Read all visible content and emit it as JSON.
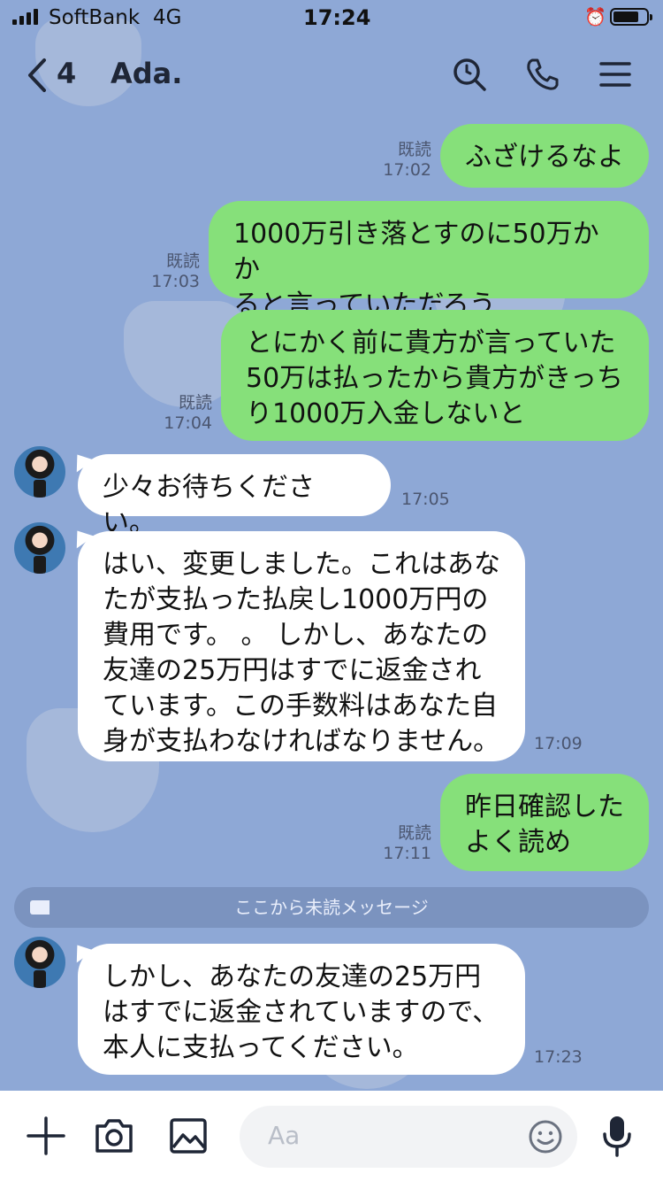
{
  "status_bar": {
    "carrier": "SoftBank",
    "network": "4G",
    "time": "17:24"
  },
  "header": {
    "unread_count": "4",
    "contact_name": "Ada."
  },
  "messages": [
    {
      "direction": "out",
      "text": [
        "ふざけるなよ"
      ],
      "read": "既読",
      "time": "17:02"
    },
    {
      "direction": "out",
      "text": [
        "1000万引き落とすのに50万かか",
        "ると言っていただろう"
      ],
      "read": "既読",
      "time": "17:03"
    },
    {
      "direction": "out",
      "text": [
        "とにかく前に貴方が言っていた",
        "50万は払ったから貴方がきっち",
        "り1000万入金しないと"
      ],
      "read": "既読",
      "time": "17:04"
    },
    {
      "direction": "in",
      "text": [
        "少々お待ちください。"
      ],
      "time": "17:05"
    },
    {
      "direction": "in",
      "text": [
        "はい、変更しました。これはあな",
        "たが支払った払戻し1000万円の",
        "費用です。 。 しかし、あなたの",
        "友達の25万円はすでに返金され",
        "ています。この手数料はあなた自",
        "身が支払わなければなりません。"
      ],
      "time": "17:09"
    },
    {
      "direction": "out",
      "text": [
        "昨日確認した",
        "よく読め"
      ],
      "read": "既読",
      "time": "17:11"
    },
    {
      "direction": "in",
      "text": [
        "しかし、あなたの友達の25万円",
        "はすでに返金されていますので、",
        "本人に支払ってください。"
      ],
      "time": "17:23"
    }
  ],
  "unread_divider": "ここから未読メッセージ",
  "input": {
    "placeholder": "Aa"
  },
  "icons": {
    "back": "chevron-left-icon",
    "search": "search-icon",
    "call": "phone-icon",
    "menu": "menu-icon",
    "add": "plus-icon",
    "camera": "camera-icon",
    "image": "image-icon",
    "emoji": "emoji-icon",
    "mic": "microphone-icon"
  },
  "colors": {
    "background": "#8ea8d6",
    "outgoing_bubble": "#86e07a",
    "incoming_bubble": "#ffffff"
  }
}
